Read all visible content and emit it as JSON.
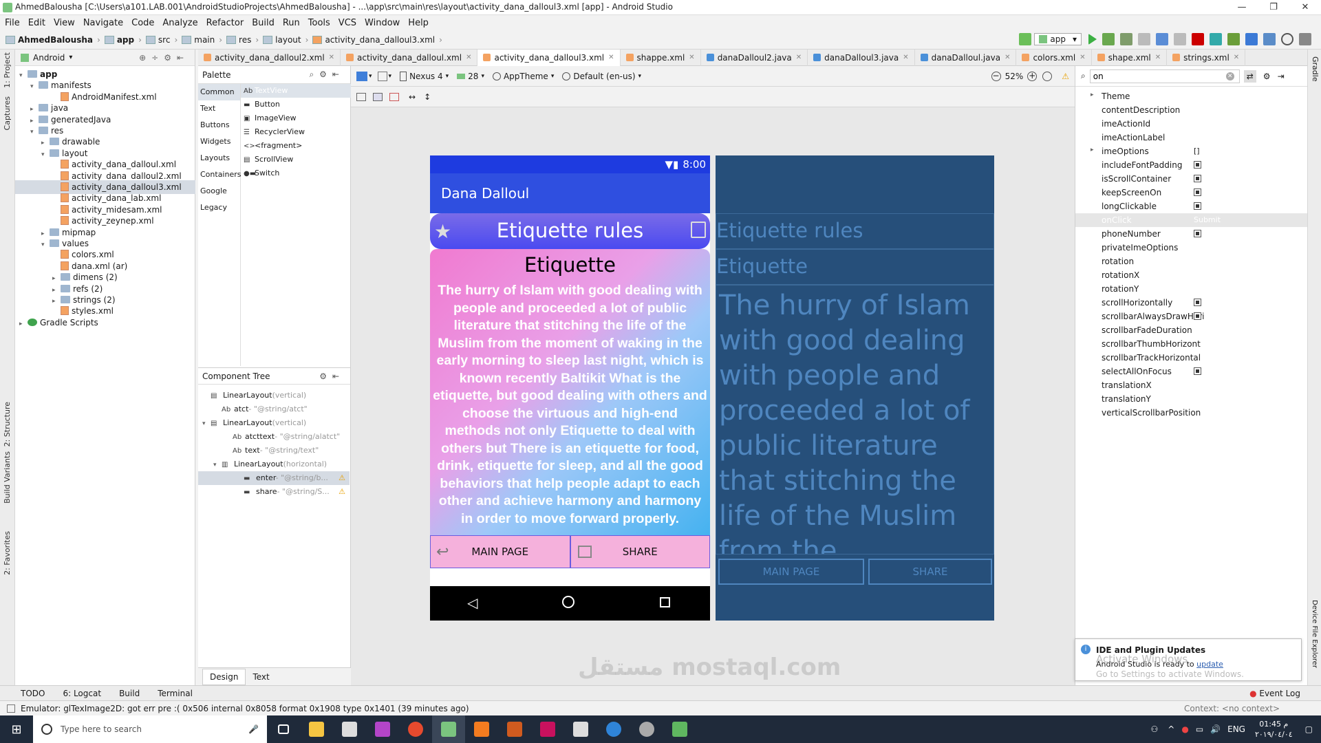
{
  "window": {
    "title": "AhmedBalousha [C:\\Users\\a101.LAB.001\\AndroidStudioProjects\\AhmedBalousha] - ...\\app\\src\\main\\res\\layout\\activity_dana_dalloul3.xml [app] - Android Studio"
  },
  "menu": [
    "File",
    "Edit",
    "View",
    "Navigate",
    "Code",
    "Analyze",
    "Refactor",
    "Build",
    "Run",
    "Tools",
    "VCS",
    "Window",
    "Help"
  ],
  "breadcrumb": [
    "AhmedBalousha",
    "app",
    "src",
    "main",
    "res",
    "layout",
    "activity_dana_dalloul3.xml"
  ],
  "run_config": "app",
  "left_tools": {
    "project": "1: Project",
    "captures": "Captures",
    "structure": "2: Structure",
    "build_variants": "Build Variants",
    "favorites": "2: Favorites"
  },
  "right_tools": {
    "gradle": "Gradle",
    "device_file_explorer": "Device File Explorer"
  },
  "project": {
    "view": "Android",
    "items": [
      {
        "label": "app",
        "indent": 0,
        "arrow": "▾",
        "icon": "folder",
        "bold": true
      },
      {
        "label": "manifests",
        "indent": 1,
        "arrow": "▾",
        "icon": "folder"
      },
      {
        "label": "AndroidManifest.xml",
        "indent": 3,
        "arrow": "",
        "icon": "xml"
      },
      {
        "label": "java",
        "indent": 1,
        "arrow": "▸",
        "icon": "folder"
      },
      {
        "label": "generatedJava",
        "indent": 1,
        "arrow": "▸",
        "icon": "folder"
      },
      {
        "label": "res",
        "indent": 1,
        "arrow": "▾",
        "icon": "folder"
      },
      {
        "label": "drawable",
        "indent": 2,
        "arrow": "▸",
        "icon": "folder"
      },
      {
        "label": "layout",
        "indent": 2,
        "arrow": "▾",
        "icon": "folder"
      },
      {
        "label": "activity_dana_dalloul.xml",
        "indent": 3,
        "arrow": "",
        "icon": "xml"
      },
      {
        "label": "activity_dana_dalloul2.xml",
        "indent": 3,
        "arrow": "",
        "icon": "xml"
      },
      {
        "label": "activity_dana_dalloul3.xml",
        "indent": 3,
        "arrow": "",
        "icon": "xml",
        "selected": true
      },
      {
        "label": "activity_dana_lab.xml",
        "indent": 3,
        "arrow": "",
        "icon": "xml"
      },
      {
        "label": "activity_midesam.xml",
        "indent": 3,
        "arrow": "",
        "icon": "xml"
      },
      {
        "label": "activity_zeynep.xml",
        "indent": 3,
        "arrow": "",
        "icon": "xml"
      },
      {
        "label": "mipmap",
        "indent": 2,
        "arrow": "▸",
        "icon": "folder"
      },
      {
        "label": "values",
        "indent": 2,
        "arrow": "▾",
        "icon": "folder"
      },
      {
        "label": "colors.xml",
        "indent": 3,
        "arrow": "",
        "icon": "xml"
      },
      {
        "label": "dana.xml (ar)",
        "indent": 3,
        "arrow": "",
        "icon": "xml"
      },
      {
        "label": "dimens (2)",
        "indent": 3,
        "arrow": "▸",
        "icon": "folder"
      },
      {
        "label": "refs (2)",
        "indent": 3,
        "arrow": "▸",
        "icon": "folder"
      },
      {
        "label": "strings (2)",
        "indent": 3,
        "arrow": "▸",
        "icon": "folder"
      },
      {
        "label": "styles.xml",
        "indent": 3,
        "arrow": "",
        "icon": "xml"
      },
      {
        "label": "Gradle Scripts",
        "indent": 0,
        "arrow": "▸",
        "icon": "gradle"
      }
    ]
  },
  "tabs": [
    {
      "label": "activity_dana_dalloul2.xml",
      "color": "#f4a261"
    },
    {
      "label": "activity_dana_dalloul.xml",
      "color": "#f4a261"
    },
    {
      "label": "activity_dana_dalloul3.xml",
      "color": "#f4a261",
      "active": true
    },
    {
      "label": "shappe.xml",
      "color": "#f4a261"
    },
    {
      "label": "danaDalloul2.java",
      "color": "#4a90d9"
    },
    {
      "label": "danaDalloul3.java",
      "color": "#4a90d9"
    },
    {
      "label": "danaDalloul.java",
      "color": "#4a90d9"
    },
    {
      "label": "colors.xml",
      "color": "#f4a261"
    },
    {
      "label": "shape.xml",
      "color": "#f4a261"
    },
    {
      "label": "strings.xml",
      "color": "#f4a261"
    }
  ],
  "palette": {
    "title": "Palette",
    "categories": [
      "Common",
      "Text",
      "Buttons",
      "Widgets",
      "Layouts",
      "Containers",
      "Google",
      "Legacy"
    ],
    "widgets": [
      {
        "icon": "Ab",
        "label": "TextView"
      },
      {
        "icon": "▬",
        "label": "Button"
      },
      {
        "icon": "▣",
        "label": "ImageView"
      },
      {
        "icon": "☰",
        "label": "RecyclerView"
      },
      {
        "icon": "<>",
        "label": "<fragment>"
      },
      {
        "icon": "▤",
        "label": "ScrollView"
      },
      {
        "icon": "●▬",
        "label": "Switch"
      }
    ]
  },
  "component_tree": {
    "title": "Component Tree",
    "items": [
      {
        "label": "LinearLayout",
        "hint": "(vertical)",
        "indent": 0,
        "arrow": "",
        "icon": "▤"
      },
      {
        "label": "atct",
        "hint": "- \"@string/atct\"",
        "indent": 1,
        "arrow": "",
        "icon": "Ab"
      },
      {
        "label": "LinearLayout",
        "hint": "(vertical)",
        "indent": 0,
        "arrow": "▾",
        "icon": "▤"
      },
      {
        "label": "atcttext",
        "hint": "- \"@string/alatct\"",
        "indent": 2,
        "arrow": "",
        "icon": "Ab"
      },
      {
        "label": "text",
        "hint": "- \"@string/text\"",
        "indent": 2,
        "arrow": "",
        "icon": "Ab"
      },
      {
        "label": "LinearLayout",
        "hint": "(horizontal)",
        "indent": 1,
        "arrow": "▾",
        "icon": "▥"
      },
      {
        "label": "enter",
        "hint": "- \"@string/b...",
        "indent": 3,
        "arrow": "",
        "icon": "▬",
        "warn": true,
        "selected": true
      },
      {
        "label": "share",
        "hint": "- \"@string/S...",
        "indent": 3,
        "arrow": "",
        "icon": "▬",
        "warn": true
      }
    ]
  },
  "design_tabs": {
    "design": "Design",
    "text": "Text"
  },
  "editor_toolbar": {
    "device": "Nexus 4",
    "api": "28",
    "theme": "AppTheme",
    "locale": "Default (en-us)",
    "zoom": "52%"
  },
  "phone": {
    "time": "8:00",
    "app_title": "Dana Dalloul",
    "header": "Etiquette rules",
    "subtitle": "Etiquette",
    "body": "The hurry of Islam with good dealing with people and proceeded a lot of public literature that stitching the life of the Muslim from the moment of waking in the early morning to sleep last night, which is known recently Baltikit What is the etiquette, but good dealing with others and choose the virtuous and high-end methods not only Etiquette to deal with others but There is an etiquette for food, drink, etiquette for sleep, and all the good behaviors that help people adapt to each other and achieve harmony and harmony in order to move forward properly.",
    "btn_main": "MAIN PAGE",
    "btn_share": "SHARE"
  },
  "blueprint": {
    "header": "Etiquette rules",
    "subtitle": "Etiquette",
    "body": "The hurry of Islam with good dealing with people and proceeded a lot of public literature that stitching the life of the Muslim from the",
    "btn_main": "MAIN PAGE",
    "btn_share": "SHARE"
  },
  "attributes": {
    "search": "on",
    "items": [
      {
        "label": "Theme",
        "arrow": "▸"
      },
      {
        "label": "contentDescription"
      },
      {
        "label": "imeActionId"
      },
      {
        "label": "imeActionLabel"
      },
      {
        "label": "imeOptions",
        "arrow": "▸",
        "value": "[]"
      },
      {
        "label": "includeFontPadding",
        "check": true
      },
      {
        "label": "isScrollContainer",
        "check": true
      },
      {
        "label": "keepScreenOn",
        "check": true
      },
      {
        "label": "longClickable",
        "check": true
      },
      {
        "label": "onClick",
        "value": "Submit",
        "highlight": true
      },
      {
        "label": "phoneNumber",
        "check": true
      },
      {
        "label": "privateImeOptions"
      },
      {
        "label": "rotation"
      },
      {
        "label": "rotationX"
      },
      {
        "label": "rotationY"
      },
      {
        "label": "scrollHorizontally",
        "check": true
      },
      {
        "label": "scrollbarAlwaysDrawHori",
        "check": true
      },
      {
        "label": "scrollbarFadeDuration"
      },
      {
        "label": "scrollbarThumbHorizont"
      },
      {
        "label": "scrollbarTrackHorizontal"
      },
      {
        "label": "selectAllOnFocus",
        "check": true
      },
      {
        "label": "translationX"
      },
      {
        "label": "translationY"
      },
      {
        "label": "verticalScrollbarPosition"
      }
    ]
  },
  "notification": {
    "title": "IDE and Plugin Updates",
    "text": "Android Studio is ready to",
    "link": "update",
    "activate1": "Activate Windows",
    "activate2": "Go to Settings to activate Windows."
  },
  "bottom_tools": {
    "todo": "TODO",
    "logcat": "6: Logcat",
    "build": "Build",
    "terminal": "Terminal",
    "event_log": "Event Log"
  },
  "status_message": "Emulator: glTexImage2D: got err pre :( 0x506 internal 0x8058 format 0x1908 type 0x1401 (39 minutes ago)",
  "status_context": "Context: <no context>",
  "taskbar": {
    "search_placeholder": "Type here to search",
    "lang": "ENG",
    "time": "01:45 م",
    "date": "٢٠١٩/٠٤/٠٤"
  },
  "watermark": "مستقل mostaql.com"
}
